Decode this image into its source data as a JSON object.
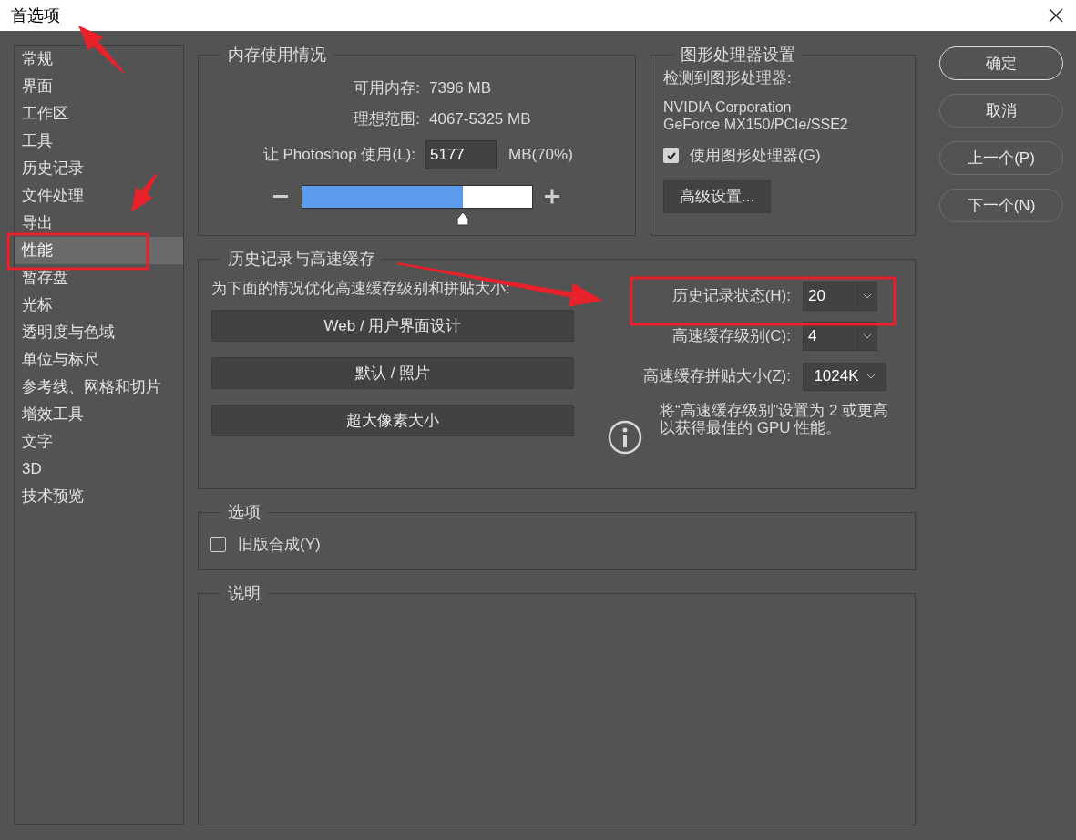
{
  "window": {
    "title": "首选项"
  },
  "sidebar": {
    "items": [
      {
        "label": "常规",
        "selected": false
      },
      {
        "label": "界面",
        "selected": false
      },
      {
        "label": "工作区",
        "selected": false
      },
      {
        "label": "工具",
        "selected": false
      },
      {
        "label": "历史记录",
        "selected": false
      },
      {
        "label": "文件处理",
        "selected": false
      },
      {
        "label": "导出",
        "selected": false
      },
      {
        "label": "性能",
        "selected": true
      },
      {
        "label": "暂存盘",
        "selected": false
      },
      {
        "label": "光标",
        "selected": false
      },
      {
        "label": "透明度与色域",
        "selected": false
      },
      {
        "label": "单位与标尺",
        "selected": false
      },
      {
        "label": "参考线、网格和切片",
        "selected": false
      },
      {
        "label": "增效工具",
        "selected": false
      },
      {
        "label": "文字",
        "selected": false
      },
      {
        "label": "3D",
        "selected": false
      },
      {
        "label": "技术预览",
        "selected": false
      }
    ]
  },
  "memory": {
    "legend": "内存使用情况",
    "rows": [
      {
        "label": "可用内存:",
        "value": "7396 MB"
      },
      {
        "label": "理想范围:",
        "value": "4067-5325 MB"
      }
    ],
    "use_label": "让 Photoshop 使用(L):",
    "use_value": "5177",
    "use_unit": "MB(70%)",
    "slider": {
      "level": 0.7
    }
  },
  "gpu": {
    "legend": "图形处理器设置",
    "detected_label": "检测到图形处理器:",
    "gpu_name": [
      "NVIDIA Corporation",
      "GeForce MX150/PCIe/SSE2"
    ],
    "use_gpu": {
      "label": "使用图形处理器(G)",
      "checked": true
    },
    "advanced_button": "高级设置..."
  },
  "history": {
    "legend": "历史记录与高速缓存",
    "hint": "为下面的情况优化高速缓存级别和拼贴大小:",
    "presets": [
      "Web / 用户界面设计",
      "默认 / 照片",
      "超大像素大小"
    ],
    "fields": [
      {
        "label": "历史记录状态(H):",
        "value": "20",
        "kind": "split"
      },
      {
        "label": "高速缓存级别(C):",
        "value": "4",
        "kind": "split"
      },
      {
        "label": "高速缓存拼贴大小(Z):",
        "value": "1024K",
        "kind": "plain"
      }
    ],
    "info": "将“高速缓存级别”设置为 2 或更高以获得最佳的 GPU 性能。"
  },
  "options": {
    "legend": "选项",
    "legacy": {
      "label": "旧版合成(Y)",
      "checked": false
    }
  },
  "description": {
    "legend": "说明"
  },
  "buttons": [
    {
      "label": "确定",
      "default": true
    },
    {
      "label": "取消",
      "default": false
    },
    {
      "label": "上一个(P)",
      "default": false
    },
    {
      "label": "下一个(N)",
      "default": false
    }
  ]
}
